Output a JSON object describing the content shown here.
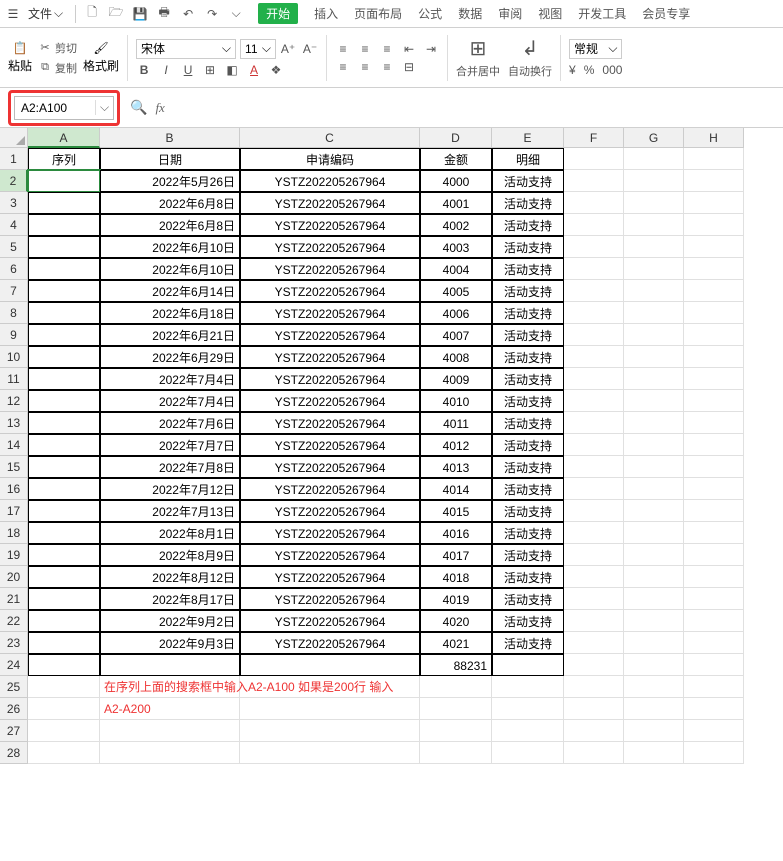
{
  "menubar": {
    "file_label": "文件",
    "tabs": [
      "开始",
      "插入",
      "页面布局",
      "公式",
      "数据",
      "审阅",
      "视图",
      "开发工具",
      "会员专享"
    ],
    "active_index": 0
  },
  "ribbon": {
    "paste_label": "粘贴",
    "cut_label": "剪切",
    "copy_label": "复制",
    "format_painter_label": "格式刷",
    "font_name": "宋体",
    "font_size": "11",
    "merge_label": "合并居中",
    "wrap_label": "自动换行",
    "number_format": "常规"
  },
  "namebox": {
    "value": "A2:A100"
  },
  "col_headers": [
    "A",
    "B",
    "C",
    "D",
    "E",
    "F",
    "G",
    "H"
  ],
  "table": {
    "headers": [
      "序列",
      "日期",
      "申请编码",
      "金额",
      "明细"
    ],
    "rows": [
      {
        "seq": "",
        "date": "2022年5月26日",
        "code": "YSTZ202205267964",
        "amount": "4000",
        "detail": "活动支持"
      },
      {
        "seq": "",
        "date": "2022年6月8日",
        "code": "YSTZ202205267964",
        "amount": "4001",
        "detail": "活动支持"
      },
      {
        "seq": "",
        "date": "2022年6月8日",
        "code": "YSTZ202205267964",
        "amount": "4002",
        "detail": "活动支持"
      },
      {
        "seq": "",
        "date": "2022年6月10日",
        "code": "YSTZ202205267964",
        "amount": "4003",
        "detail": "活动支持"
      },
      {
        "seq": "",
        "date": "2022年6月10日",
        "code": "YSTZ202205267964",
        "amount": "4004",
        "detail": "活动支持"
      },
      {
        "seq": "",
        "date": "2022年6月14日",
        "code": "YSTZ202205267964",
        "amount": "4005",
        "detail": "活动支持"
      },
      {
        "seq": "",
        "date": "2022年6月18日",
        "code": "YSTZ202205267964",
        "amount": "4006",
        "detail": "活动支持"
      },
      {
        "seq": "",
        "date": "2022年6月21日",
        "code": "YSTZ202205267964",
        "amount": "4007",
        "detail": "活动支持"
      },
      {
        "seq": "",
        "date": "2022年6月29日",
        "code": "YSTZ202205267964",
        "amount": "4008",
        "detail": "活动支持"
      },
      {
        "seq": "",
        "date": "2022年7月4日",
        "code": "YSTZ202205267964",
        "amount": "4009",
        "detail": "活动支持"
      },
      {
        "seq": "",
        "date": "2022年7月4日",
        "code": "YSTZ202205267964",
        "amount": "4010",
        "detail": "活动支持"
      },
      {
        "seq": "",
        "date": "2022年7月6日",
        "code": "YSTZ202205267964",
        "amount": "4011",
        "detail": "活动支持"
      },
      {
        "seq": "",
        "date": "2022年7月7日",
        "code": "YSTZ202205267964",
        "amount": "4012",
        "detail": "活动支持"
      },
      {
        "seq": "",
        "date": "2022年7月8日",
        "code": "YSTZ202205267964",
        "amount": "4013",
        "detail": "活动支持"
      },
      {
        "seq": "",
        "date": "2022年7月12日",
        "code": "YSTZ202205267964",
        "amount": "4014",
        "detail": "活动支持"
      },
      {
        "seq": "",
        "date": "2022年7月13日",
        "code": "YSTZ202205267964",
        "amount": "4015",
        "detail": "活动支持"
      },
      {
        "seq": "",
        "date": "2022年8月1日",
        "code": "YSTZ202205267964",
        "amount": "4016",
        "detail": "活动支持"
      },
      {
        "seq": "",
        "date": "2022年8月9日",
        "code": "YSTZ202205267964",
        "amount": "4017",
        "detail": "活动支持"
      },
      {
        "seq": "",
        "date": "2022年8月12日",
        "code": "YSTZ202205267964",
        "amount": "4018",
        "detail": "活动支持"
      },
      {
        "seq": "",
        "date": "2022年8月17日",
        "code": "YSTZ202205267964",
        "amount": "4019",
        "detail": "活动支持"
      },
      {
        "seq": "",
        "date": "2022年9月2日",
        "code": "YSTZ202205267964",
        "amount": "4020",
        "detail": "活动支持"
      },
      {
        "seq": "",
        "date": "2022年9月3日",
        "code": "YSTZ202205267964",
        "amount": "4021",
        "detail": "活动支持"
      }
    ],
    "sum_row_amount": "88231"
  },
  "annotation": {
    "line1": "在序列上面的搜索框中输入A2-A100  如果是200行 输入",
    "line2": "A2-A200"
  },
  "row_count": 28
}
